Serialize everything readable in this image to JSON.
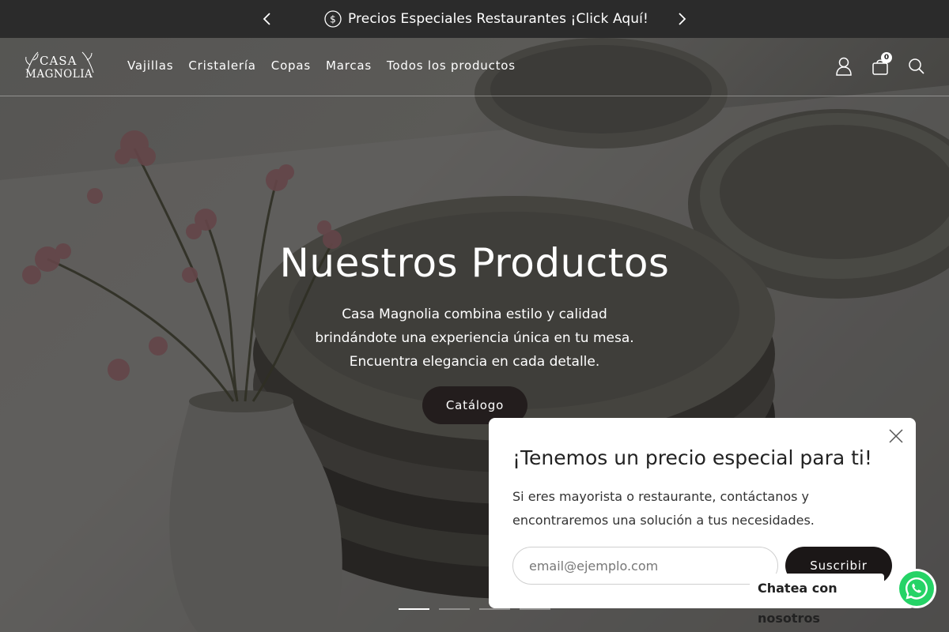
{
  "announcement": {
    "text": "Precios Especiales Restaurantes ¡Click Aquí!",
    "coin_icon": "dollar-coin-icon"
  },
  "header": {
    "logo_line1": "CASA",
    "logo_line2": "MAGNOLIA",
    "nav": [
      "Vajillas",
      "Cristalería",
      "Copas",
      "Marcas",
      "Todos los productos"
    ],
    "cart_count": "0"
  },
  "hero": {
    "title": "Nuestros Productos",
    "subtitle_lines": [
      "Casa Magnolia combina estilo y calidad",
      "brindándote una experiencia única en tu mesa.",
      "Encuentra elegancia en cada detalle."
    ],
    "cta_label": "Catálogo",
    "active_slide": 1,
    "slide_count": 4
  },
  "popup": {
    "title": "¡Tenemos un precio especial para ti!",
    "body": "Si eres mayorista o restaurante, contáctanos y encontraremos una solución a tus necesidades.",
    "email_placeholder": "email@ejemplo.com",
    "submit_label": "Suscribir"
  },
  "chat": {
    "label": "Chatea con nosotros"
  },
  "colors": {
    "announcement_bg": "#2b2b2b",
    "cta_bg": "#231d1d",
    "whatsapp_green": "#25d366"
  }
}
